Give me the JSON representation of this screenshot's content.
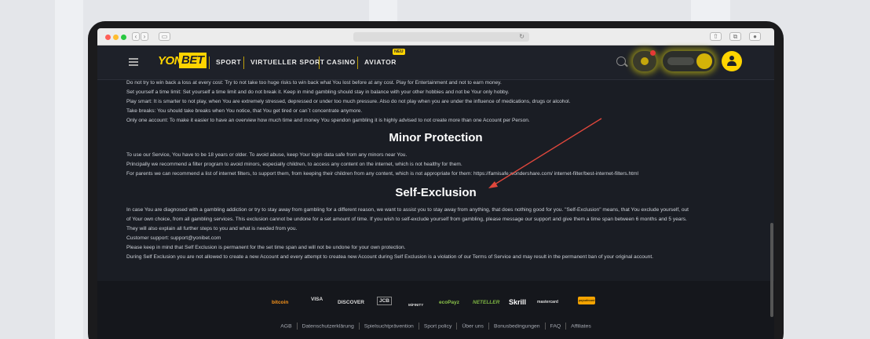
{
  "browser": {
    "nav_back": "‹",
    "nav_forward": "›",
    "sidebar": "▭",
    "reload": "↻",
    "share": "⇧",
    "tabs": "⧉",
    "extension": "●"
  },
  "nav": {
    "logo_part1": "YONI",
    "logo_part2": "BET",
    "items": [
      "SPORT",
      "VIRTUELLER SPORT",
      "CASINO",
      "AVIATOR"
    ],
    "new_badge": "NEU"
  },
  "content": {
    "intro_lines": [
      "Do not try to win back a loss at every cost: Try to not take too huge risks to win back what You lost before at any cost. Play for Entertainment and not to earn money.",
      "Set yourself a time limit: Set yourself a time limit and do not break it. Keep in mind gambling should stay in balance with your other hobbies and not be Your only hobby.",
      "Play smart: It is smarter to not play, when You are extremely stressed, depressed or under too much pressure. Also do not play when you are under the influence of medications, drugs or alcohol.",
      "Take breaks: You should take breaks when You notice, that You get tired or can´t concentrate anymore.",
      "Only one account: To make it easier to have an overview how much time and money You spendon gambling it is highly advised to not create more than one Account per Person."
    ],
    "minor_title": "Minor Protection",
    "minor_lines": [
      "To use our Service, You have to be 18 years or older. To avoid abuse, keep Your login data safe from any minors near You.",
      "Principally we recommend a filter program to avoid minors, especially children, to access any content on the internet, which is not healthy for them.",
      "For parents we can recommend a list of internet filters, to support them, from keeping their children from any content, which is not appropriate for them: https://famisafe.wondershare.com/ internet-filter/best-internet-filters.html"
    ],
    "self_title": "Self-Exclusion",
    "self_lines": [
      "In case You are diagnosed with a gambling addiction or try to stay away from gambling for a different reason, we want to assist you to stay away from anything, that does nothing good for you. \"Self-Exclusion\" means, that You exclude yourself, out",
      "of Your own choice, from all gambling services. This exclusion cannot be undone for a set amount of time. If you wish to self-exclude yourself from gambling, please message our support and give them a time span between 6 months and 5 years.",
      "They will also explain all further steps to you and what is needed from you.",
      "Customer support: support@yonibet.com",
      "Please keep in mind that Self Exclusion is permanent for the set time span and will not be undone for your own protection.",
      "During Self Exclusion you are not allowed to create a new Account and every attempt to createa new Account during Self Exclusion is a violation of our Terms of Service and may result in the permanent ban of your original account."
    ]
  },
  "footer": {
    "payments": [
      "bitcoin",
      "VISA",
      "DISCOVER",
      "JCB",
      "MiFINITY",
      "ecoPayz",
      "NETELLER",
      "Skrill",
      "mastercard",
      "paysafecard"
    ],
    "links": [
      "AGB",
      "Datenschutzerklärung",
      "Spielsuchtprävention",
      "Sport policy",
      "Über uns",
      "Bonusbedingungen",
      "FAQ",
      "Affiliates"
    ]
  },
  "colors": {
    "accent": "#ffd400",
    "page_bg": "#1a1d24",
    "arrow": "#e0473c"
  }
}
